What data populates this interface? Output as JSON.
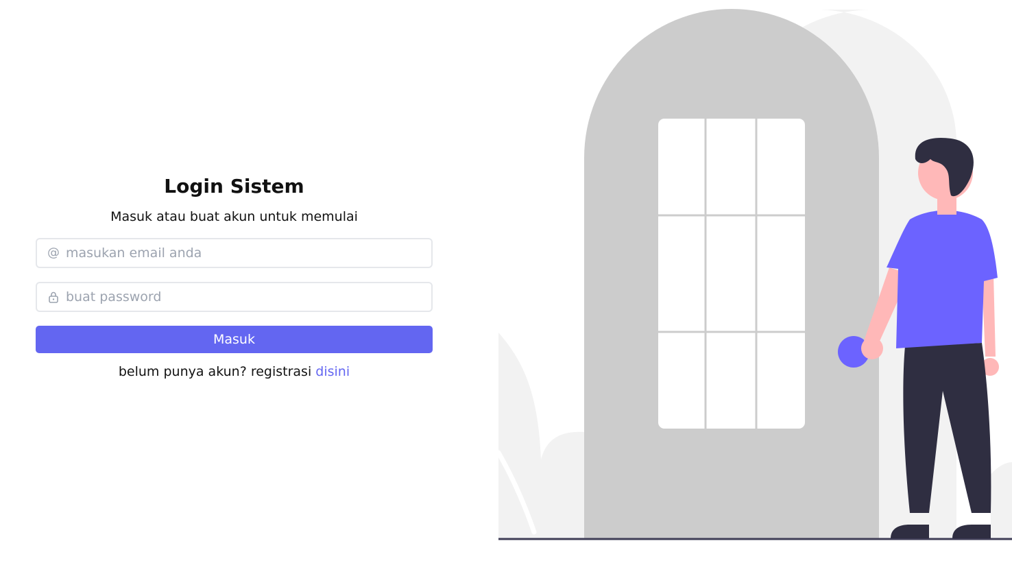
{
  "login": {
    "title": "Login Sistem",
    "subtitle": "Masuk atau buat akun untuk memulai",
    "email": {
      "placeholder": "masukan email anda",
      "icon": "at-icon"
    },
    "password": {
      "placeholder": "buat password",
      "icon": "lock-icon"
    },
    "submit_label": "Masuk",
    "register_prompt": "belum punya akun? registrasi",
    "register_link": "disini"
  },
  "colors": {
    "accent": "#6366f1",
    "field_border": "#e5e7eb",
    "placeholder": "#9ca3af",
    "door": "#cccccc",
    "background_shape": "#f2f2f2",
    "figure_shirt": "#6c63ff",
    "figure_pants": "#2f2e41",
    "figure_skin": "#ffb8b8"
  }
}
